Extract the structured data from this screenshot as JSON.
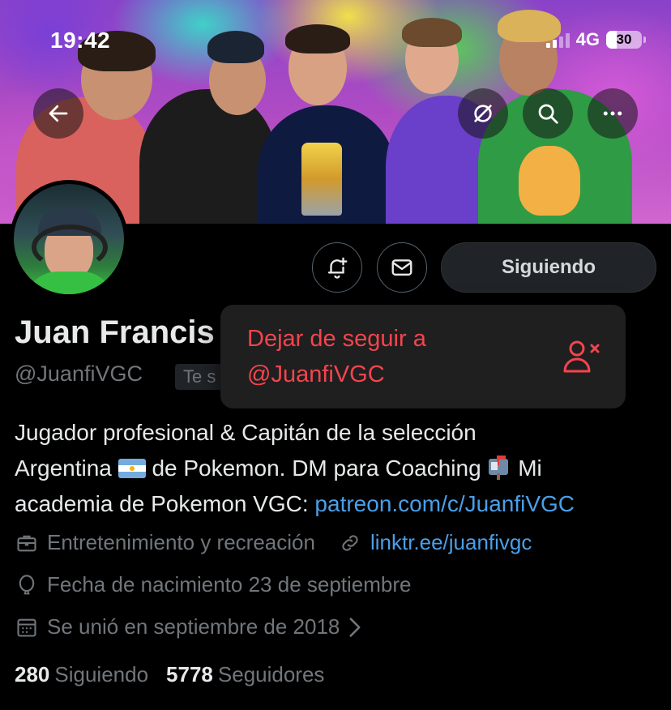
{
  "status_bar": {
    "time": "19:42",
    "network": "4G",
    "battery": "30",
    "battery_level": 0.3
  },
  "banner": {
    "back_icon": "arrow-left-icon",
    "spoiler_icon": "eye-slash-icon",
    "search_icon": "search-icon",
    "more_icon": "more-horizontal-icon"
  },
  "profile": {
    "display_name": "Juan Francis",
    "handle": "@JuanfiVGC",
    "follows_you": "Te s",
    "follow_button": "Siguiendo",
    "bio": {
      "line1": "Jugador profesional & Capitán de la selección",
      "line2a": "Argentina",
      "line2b": "de Pokemon. DM para Coaching",
      "line2c": "Mi",
      "line3": "academia de Pokemon VGC:",
      "link": "patreon.com/c/JuanfiVGC"
    },
    "category": "Entretenimiento y recreación",
    "website": "linktr.ee/juanfivgc",
    "birthday": "Fecha de nacimiento 23 de septiembre",
    "joined": "Se unió en septiembre de 2018",
    "following_count": "280",
    "following_label": "Siguiendo",
    "followers_count": "5778",
    "followers_label": "Seguidores"
  },
  "popup": {
    "line1": "Dejar de seguir a",
    "line2": "@JuanfiVGC",
    "icon": "person-remove-icon"
  },
  "colors": {
    "accent_link": "#4a9fe8",
    "danger": "#f4444e",
    "muted": "#71767b"
  }
}
